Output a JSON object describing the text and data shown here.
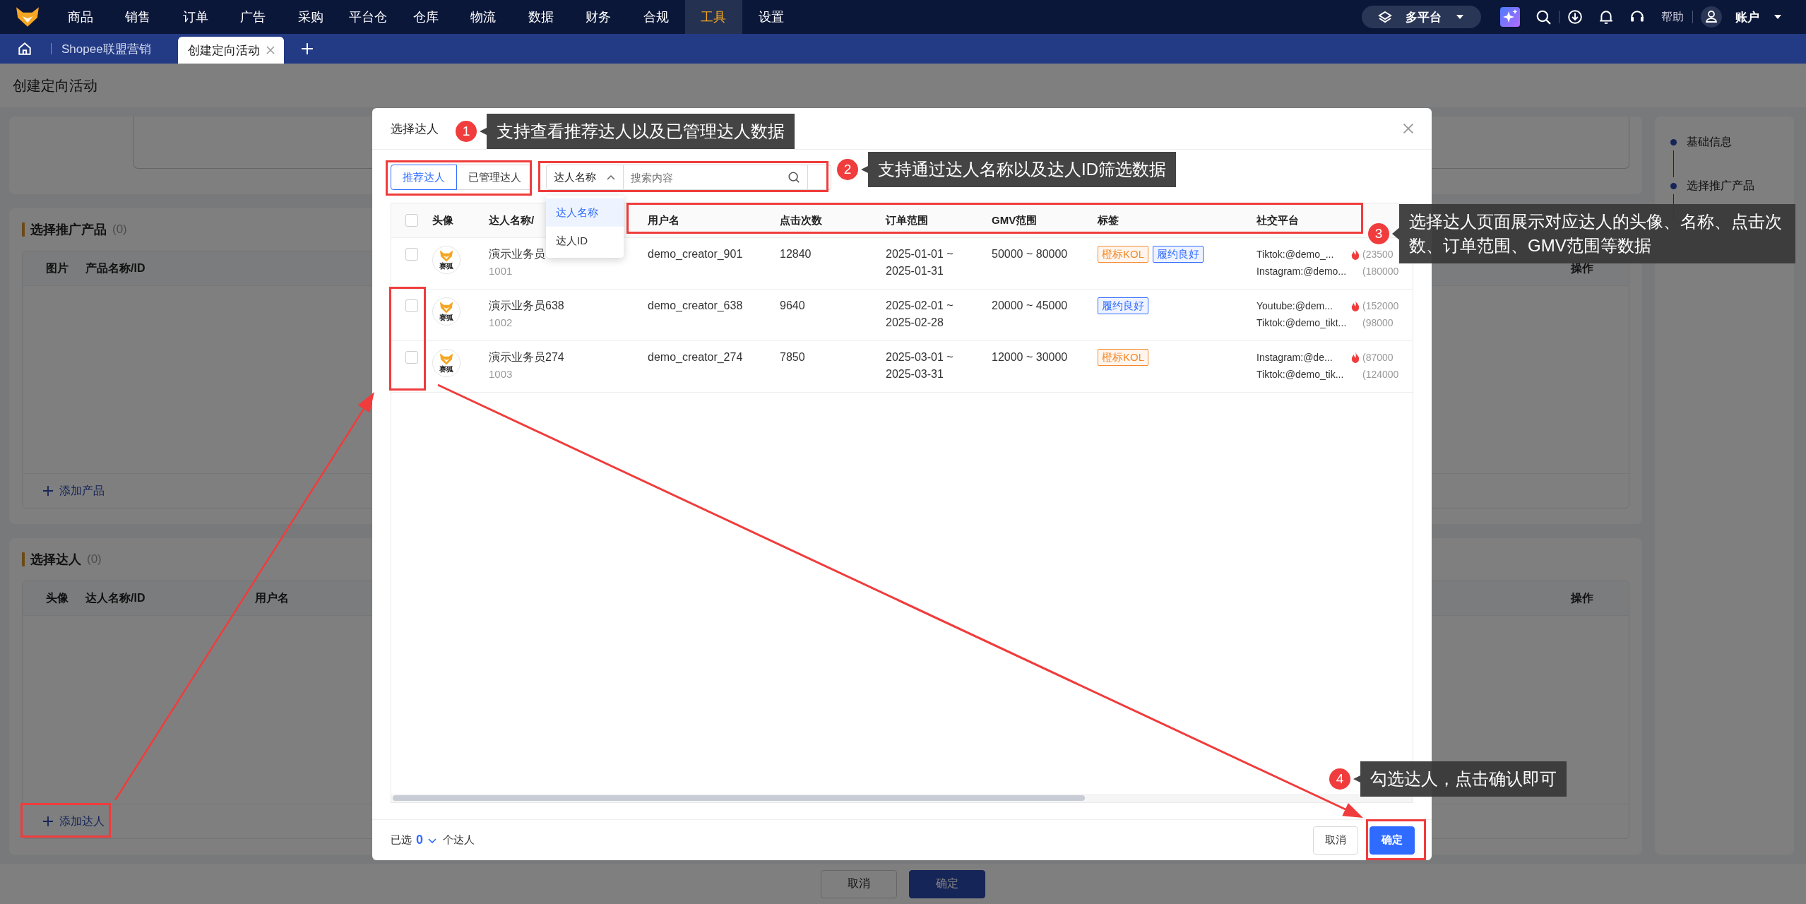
{
  "nav": {
    "items": [
      {
        "label": "商品",
        "selected": false
      },
      {
        "label": "销售",
        "selected": false
      },
      {
        "label": "订单",
        "selected": false
      },
      {
        "label": "广告",
        "selected": false
      },
      {
        "label": "采购",
        "selected": false
      },
      {
        "label": "平台仓",
        "selected": false
      },
      {
        "label": "仓库",
        "selected": false
      },
      {
        "label": "物流",
        "selected": false
      },
      {
        "label": "数据",
        "selected": false
      },
      {
        "label": "财务",
        "selected": false
      },
      {
        "label": "合规",
        "selected": false
      },
      {
        "label": "工具",
        "selected": true
      },
      {
        "label": "设置",
        "selected": false
      }
    ],
    "platform": "多平台",
    "help": "帮助",
    "account": "账户"
  },
  "tabs": [
    {
      "label": "Shopee联盟营销",
      "selected": false,
      "closable": false
    },
    {
      "label": "创建定向活动",
      "selected": true,
      "closable": true
    }
  ],
  "page": {
    "title": "创建定向活动",
    "products": {
      "title": "选择推广产品",
      "count": "(0)",
      "columns": [
        "图片",
        "产品名称/ID"
      ],
      "action_column": "操作",
      "add": "添加产品"
    },
    "creators": {
      "title": "选择达人",
      "count": "(0)",
      "columns": [
        "头像",
        "达人名称/ID",
        "用户名"
      ],
      "action_column": "操作",
      "add": "添加达人"
    },
    "steps": [
      {
        "label": "基础信息"
      },
      {
        "label": "选择推广产品"
      }
    ],
    "buttons": [
      {
        "label": "取消",
        "kind": "default"
      },
      {
        "label": "确定",
        "kind": "primary"
      }
    ]
  },
  "modal": {
    "title": "选择达人",
    "tabs": [
      {
        "label": "推荐达人",
        "selected": true
      },
      {
        "label": "已管理达人",
        "selected": false
      }
    ],
    "filter": {
      "field": "达人名称",
      "expanded": true,
      "placeholder": "搜索内容",
      "options": [
        {
          "label": "达人名称",
          "selected": true
        },
        {
          "label": "达人ID",
          "selected": false
        }
      ]
    },
    "table": {
      "select_all_checked": false,
      "columns": [
        "头像",
        "达人名称/",
        "用户名",
        "点击次数",
        "订单范围",
        "GMV范围",
        "标签",
        "社交平台"
      ],
      "rows": [
        {
          "checked": false,
          "avatar_label": "赛狐",
          "name": "演示业务员",
          "id": "1001",
          "username": "demo_creator_901",
          "clicks": "12840",
          "order_range": "2025-01-01 ~ 2025-01-31",
          "gmv_range": "50000 ~ 80000",
          "tags": [
            {
              "label": "橙标KOL",
              "color": "#f5892b"
            },
            {
              "label": "履约良好",
              "color": "#2f6bff"
            }
          ],
          "social": [
            {
              "account": "Tiktok:@demo_...",
              "followers": "(23500",
              "hot": true
            },
            {
              "account": "Instagram:@demo...",
              "followers": "(180000",
              "hot": false
            }
          ]
        },
        {
          "checked": false,
          "avatar_label": "赛狐",
          "name": "演示业务员638",
          "id": "1002",
          "username": "demo_creator_638",
          "clicks": "9640",
          "order_range": "2025-02-01 ~ 2025-02-28",
          "gmv_range": "20000 ~ 45000",
          "tags": [
            {
              "label": "履约良好",
              "color": "#2f6bff"
            }
          ],
          "social": [
            {
              "account": "Youtube:@dem...",
              "followers": "(152000",
              "hot": true
            },
            {
              "account": "Tiktok:@demo_tikt...",
              "followers": "(98000",
              "hot": false
            }
          ]
        },
        {
          "checked": false,
          "avatar_label": "赛狐",
          "name": "演示业务员274",
          "id": "1003",
          "username": "demo_creator_274",
          "clicks": "7850",
          "order_range": "2025-03-01 ~ 2025-03-31",
          "gmv_range": "12000 ~ 30000",
          "tags": [
            {
              "label": "橙标KOL",
              "color": "#f5892b"
            }
          ],
          "social": [
            {
              "account": "Instagram:@de...",
              "followers": "(87000",
              "hot": true
            },
            {
              "account": "Tiktok:@demo_tik...",
              "followers": "(124000",
              "hot": false
            }
          ]
        }
      ]
    },
    "footer": {
      "selected_label": "已选",
      "selected_count": "0",
      "unit": "个达人",
      "buttons": [
        {
          "label": "取消",
          "kind": "default"
        },
        {
          "label": "确定",
          "kind": "primary"
        }
      ]
    }
  },
  "annotations": [
    {
      "number": "1",
      "text": "支持查看推荐达人以及已管理达人数据"
    },
    {
      "number": "2",
      "text": "支持通过达人名称以及达人ID筛选数据"
    },
    {
      "number": "3",
      "text": "选择达人页面展示对应达人的头像、名称、点击次数、订单范围、GMV范围等数据"
    },
    {
      "number": "4",
      "text": "勾选达人，点击确认即可"
    }
  ]
}
